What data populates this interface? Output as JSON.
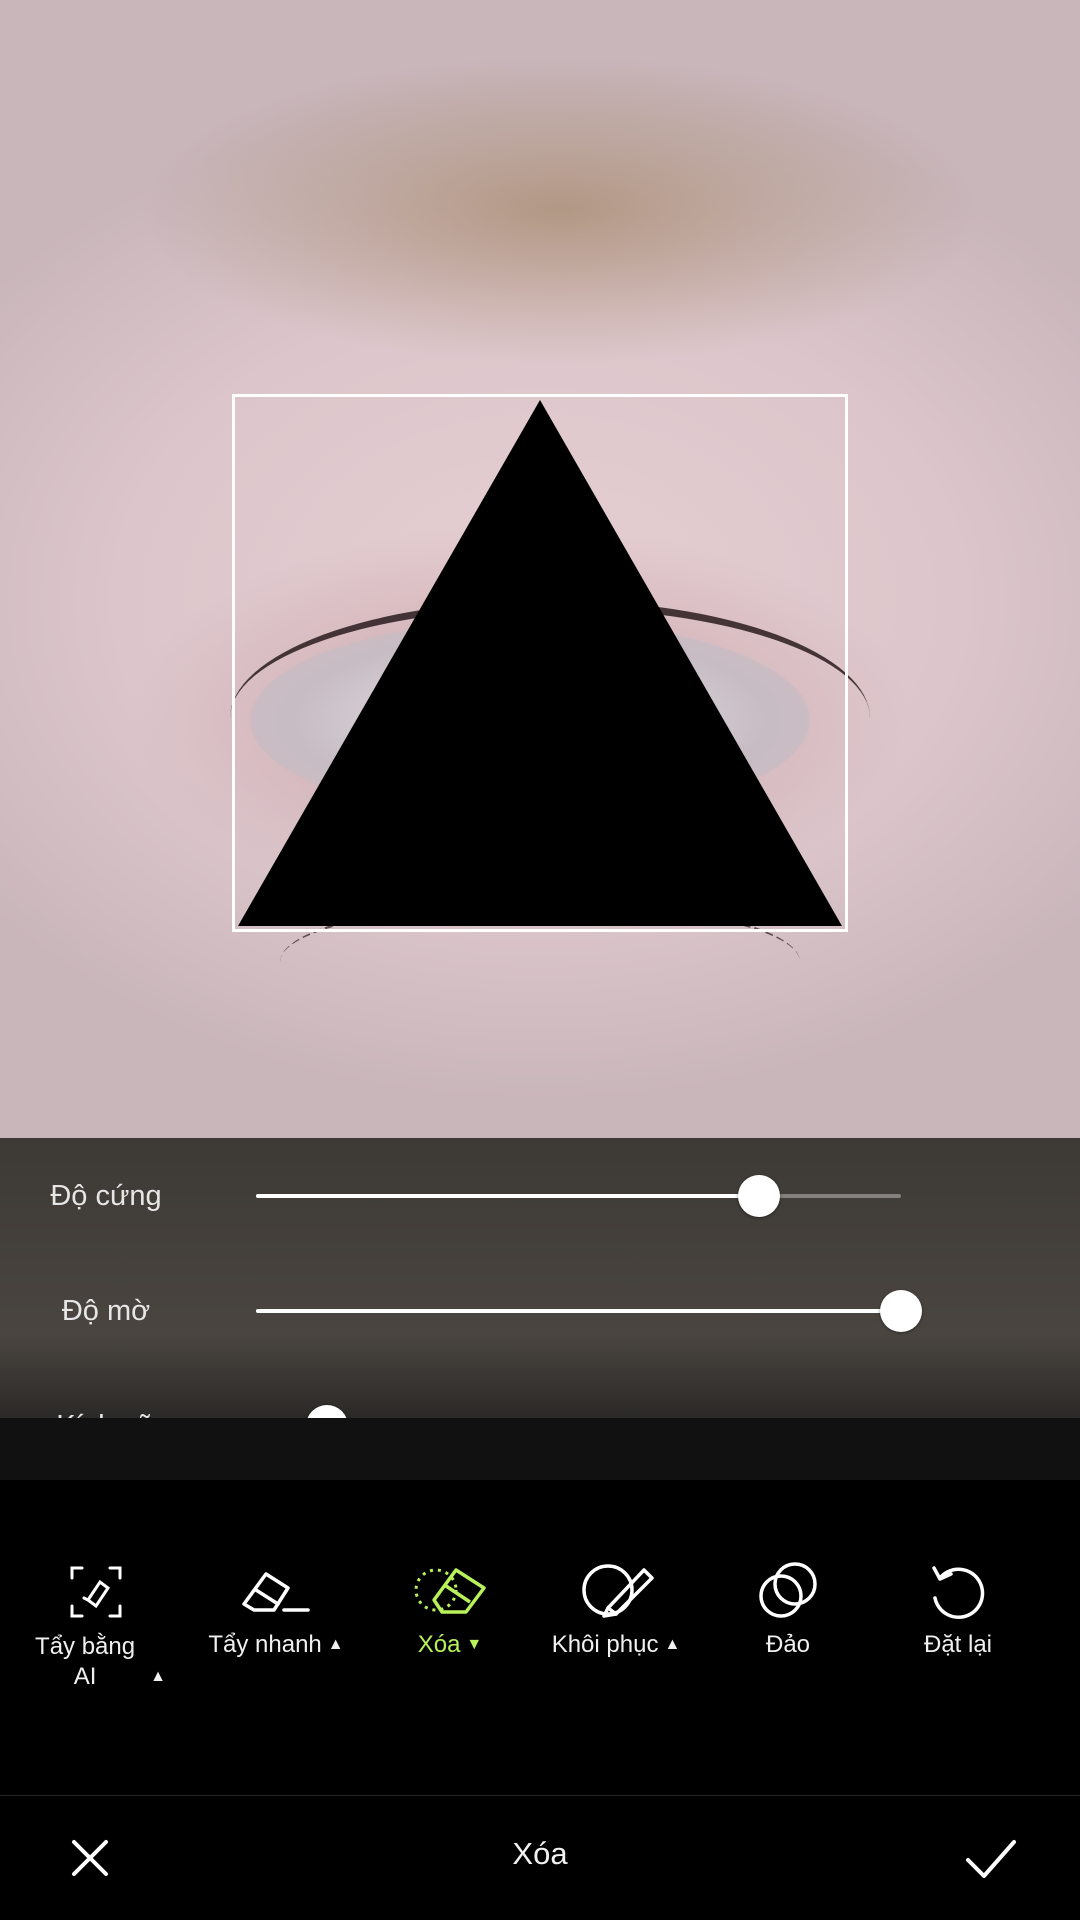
{
  "canvas": {
    "selection_shape": "triangle-icon"
  },
  "sliders": [
    {
      "label": "Độ cứng",
      "value": 0.78,
      "icon": "none"
    },
    {
      "label": "Độ mờ",
      "value": 1.0,
      "icon": "none"
    },
    {
      "label": "Kích cỡ",
      "value": 0.11,
      "marker": 0.39
    }
  ],
  "tools": [
    {
      "label": "Tẩy bằng AI",
      "icon": "ai-eraser-icon",
      "caret": "▲",
      "active": false
    },
    {
      "label": "Tẩy nhanh",
      "icon": "quick-eraser-icon",
      "caret": "▲",
      "active": false
    },
    {
      "label": "Xóa",
      "icon": "erase-icon",
      "caret": "▼",
      "active": true
    },
    {
      "label": "Khôi phục",
      "icon": "restore-brush-icon",
      "caret": "▲",
      "active": false
    },
    {
      "label": "Đảo",
      "icon": "invert-icon",
      "active": false
    },
    {
      "label": "Đặt lại",
      "icon": "reset-icon",
      "active": false
    }
  ],
  "bottom_bar": {
    "title": "Xóa",
    "cancel_icon": "close-icon",
    "confirm_icon": "checkmark-icon"
  },
  "colors": {
    "active_accent": "#b7f25a",
    "panel_bg": "#45403b"
  }
}
